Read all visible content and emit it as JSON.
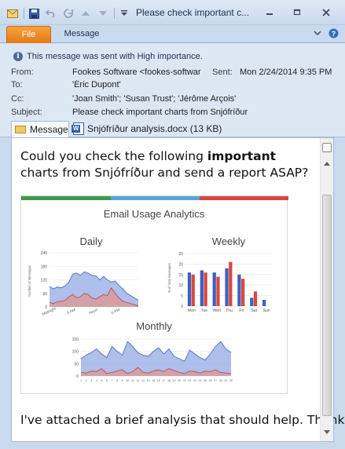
{
  "window": {
    "title": "Please check important c...",
    "minimize_icon": "minimize-icon",
    "restore_icon": "restore-icon",
    "close_icon": "close-icon"
  },
  "ribbon": {
    "file_label": "File",
    "message_label": "Message"
  },
  "header": {
    "importance_text": "This message was sent with High importance.",
    "from_label": "From:",
    "from_value": "Fookes Software <fookes-softwar",
    "sent_label": "Sent:",
    "sent_value": "Mon 2/24/2014 9:35 PM",
    "to_label": "To:",
    "to_value": "'Éric Dupont'",
    "cc_label": "Cc:",
    "cc_value": "'Joan Smith'; 'Susan Trust'; 'Jérôme Arçois'",
    "subject_label": "Subject:",
    "subject_value": "Please check important charts from Snjófríður"
  },
  "attachments": {
    "message_tab": "Message",
    "file": "Snjófríður analysis.docx (13 KB)"
  },
  "body": {
    "intro_before": "Could you check the following ",
    "intro_bold": "important",
    "intro_after": " charts from Snjófríður and send a report ASAP?",
    "closing": "I've attached a brief analysis that should help. Thanks!"
  },
  "colors": {
    "strip": [
      "#3d9a4a",
      "#5aa3d6",
      "#d9463f"
    ],
    "area_blue": "#9fb4e6",
    "area_red": "#d99a9f",
    "bar_blue": "#3f5fc0",
    "bar_red": "#d9483e"
  },
  "chart_data": [
    {
      "type": "area",
      "title": "Daily",
      "ylabel": "Number of Messages",
      "ylim": [
        0,
        240
      ],
      "y_ticks": [
        "240",
        "180",
        "120",
        "60",
        "0"
      ],
      "x_ticks": [
        "Midnight",
        "6 AM",
        "Noon",
        "6 PM"
      ],
      "series": [
        {
          "values": [
            90,
            80,
            88,
            85,
            92,
            110,
            145,
            150,
            140,
            155,
            150,
            140,
            138,
            120,
            135,
            120,
            110,
            115,
            95,
            80,
            60,
            50,
            40,
            30
          ]
        },
        {
          "values": [
            20,
            15,
            22,
            25,
            28,
            45,
            55,
            40,
            45,
            60,
            55,
            40,
            35,
            45,
            55,
            50,
            85,
            60,
            40,
            25,
            20,
            15,
            10,
            5
          ]
        }
      ]
    },
    {
      "type": "bar",
      "title": "Weekly",
      "ylabel": "% of total messages",
      "ylim": [
        0,
        25
      ],
      "y_ticks": [
        "25",
        "20",
        "15",
        "10",
        "5",
        "0"
      ],
      "categories": [
        "Mon",
        "Tue",
        "Wed",
        "Thu",
        "Fri",
        "Sat",
        "Sun"
      ],
      "series": [
        {
          "values": [
            16,
            17,
            16,
            18,
            15,
            4,
            3
          ]
        },
        {
          "values": [
            15,
            16,
            14,
            21,
            13,
            7,
            0
          ]
        }
      ]
    },
    {
      "type": "area",
      "title": "Monthly",
      "ylim": [
        0,
        150
      ],
      "y_ticks": [
        "150",
        "100",
        "50",
        "0"
      ],
      "x_ticks": [
        "1",
        "2",
        "3",
        "4",
        "5",
        "6",
        "7",
        "8",
        "9",
        "10",
        "11",
        "12",
        "13",
        "14",
        "15",
        "16",
        "17",
        "18",
        "19",
        "20",
        "21",
        "22",
        "23",
        "24",
        "25",
        "26",
        "27",
        "28",
        "29",
        "30"
      ],
      "series": [
        {
          "values": [
            70,
            85,
            95,
            110,
            90,
            75,
            120,
            100,
            85,
            140,
            120,
            95,
            85,
            80,
            100,
            115,
            90,
            110,
            80,
            70,
            60,
            105,
            90,
            75,
            65,
            90,
            120,
            140,
            110,
            95
          ]
        },
        {
          "values": [
            15,
            12,
            20,
            18,
            30,
            10,
            15,
            20,
            25,
            10,
            18,
            35,
            15,
            12,
            20,
            25,
            18,
            30,
            22,
            15,
            10,
            20,
            18,
            12,
            20,
            18,
            25,
            15,
            12,
            10
          ]
        }
      ]
    }
  ],
  "infographic_title": "Email Usage Analytics"
}
